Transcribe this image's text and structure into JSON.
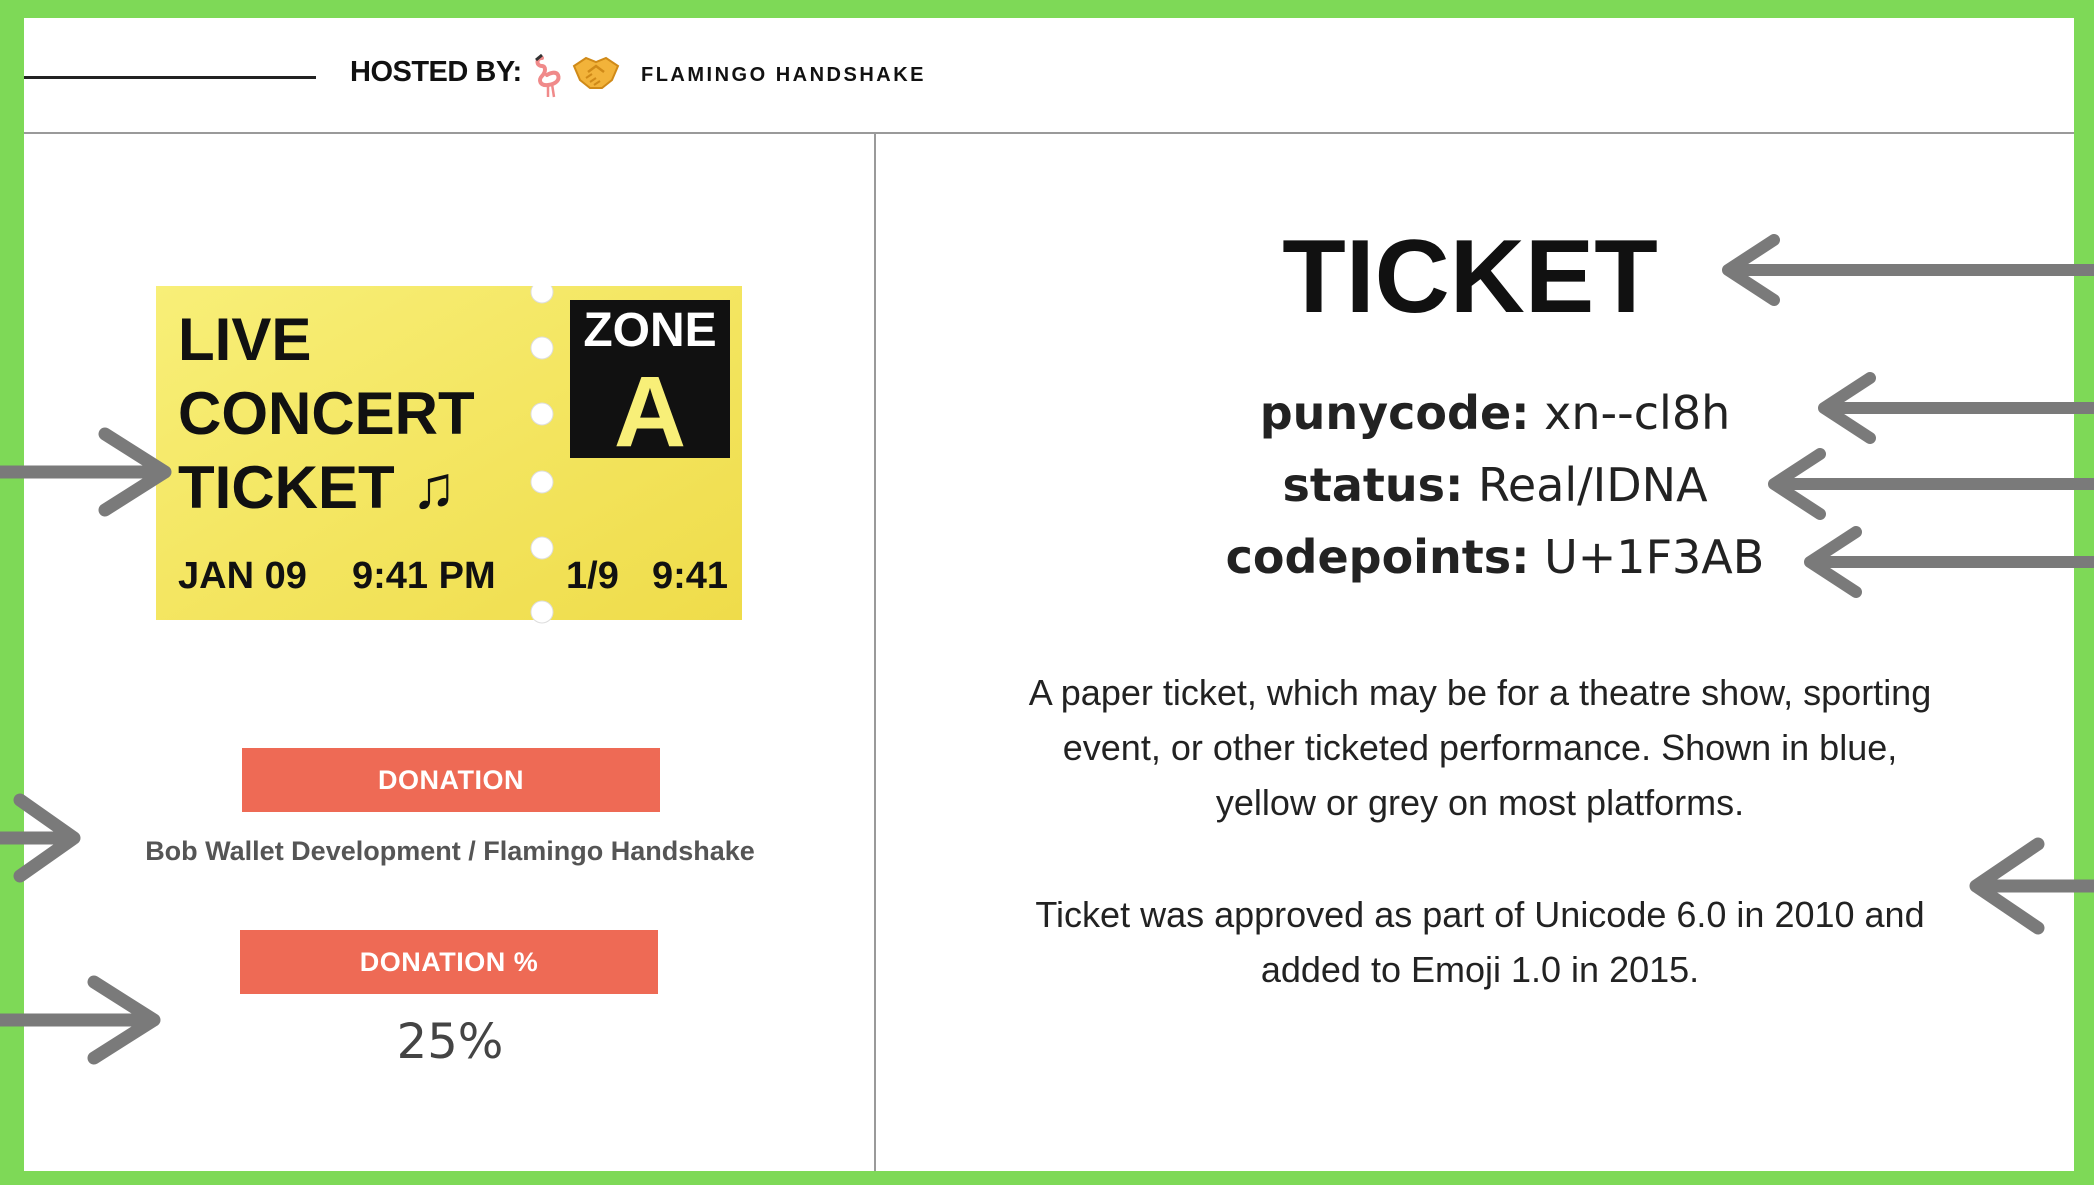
{
  "header": {
    "hosted_by_label": "HOSTED BY:",
    "host_name": "FLAMINGO HANDSHAKE"
  },
  "ticket_image": {
    "line1": "LIVE",
    "line2": "CONCERT",
    "line3": "TICKET ♫",
    "zone_label": "ZONE",
    "zone_letter": "A",
    "date": "JAN 09",
    "time": "9:41 PM",
    "stub_date": "1/9",
    "stub_time": "9:41",
    "colors": {
      "ticket": "#f5e96a",
      "zone_bg": "#111111"
    }
  },
  "donation": {
    "label": "DONATION",
    "recipient": "Bob Wallet Development / Flamingo Handshake",
    "pct_label": "DONATION %",
    "pct_value": "25%"
  },
  "emoji": {
    "name": "TICKET",
    "punycode_key": "punycode:",
    "punycode_value": "xn--cl8h",
    "status_key": "status:",
    "status_value": "Real/IDNA",
    "codepoints_key": "codepoints:",
    "codepoints_value": "U+1F3AB",
    "description": "A paper ticket, which may be for a theatre show, sporting event, or other ticketed performance. Shown in blue, yellow or grey on most platforms.",
    "history": "Ticket was approved as part of Unicode 6.0 in 2010 and added to Emoji 1.0 in 2015."
  },
  "colors": {
    "frame": "#7ed957",
    "button": "#ee6a55",
    "arrow": "#7a7a7a"
  }
}
